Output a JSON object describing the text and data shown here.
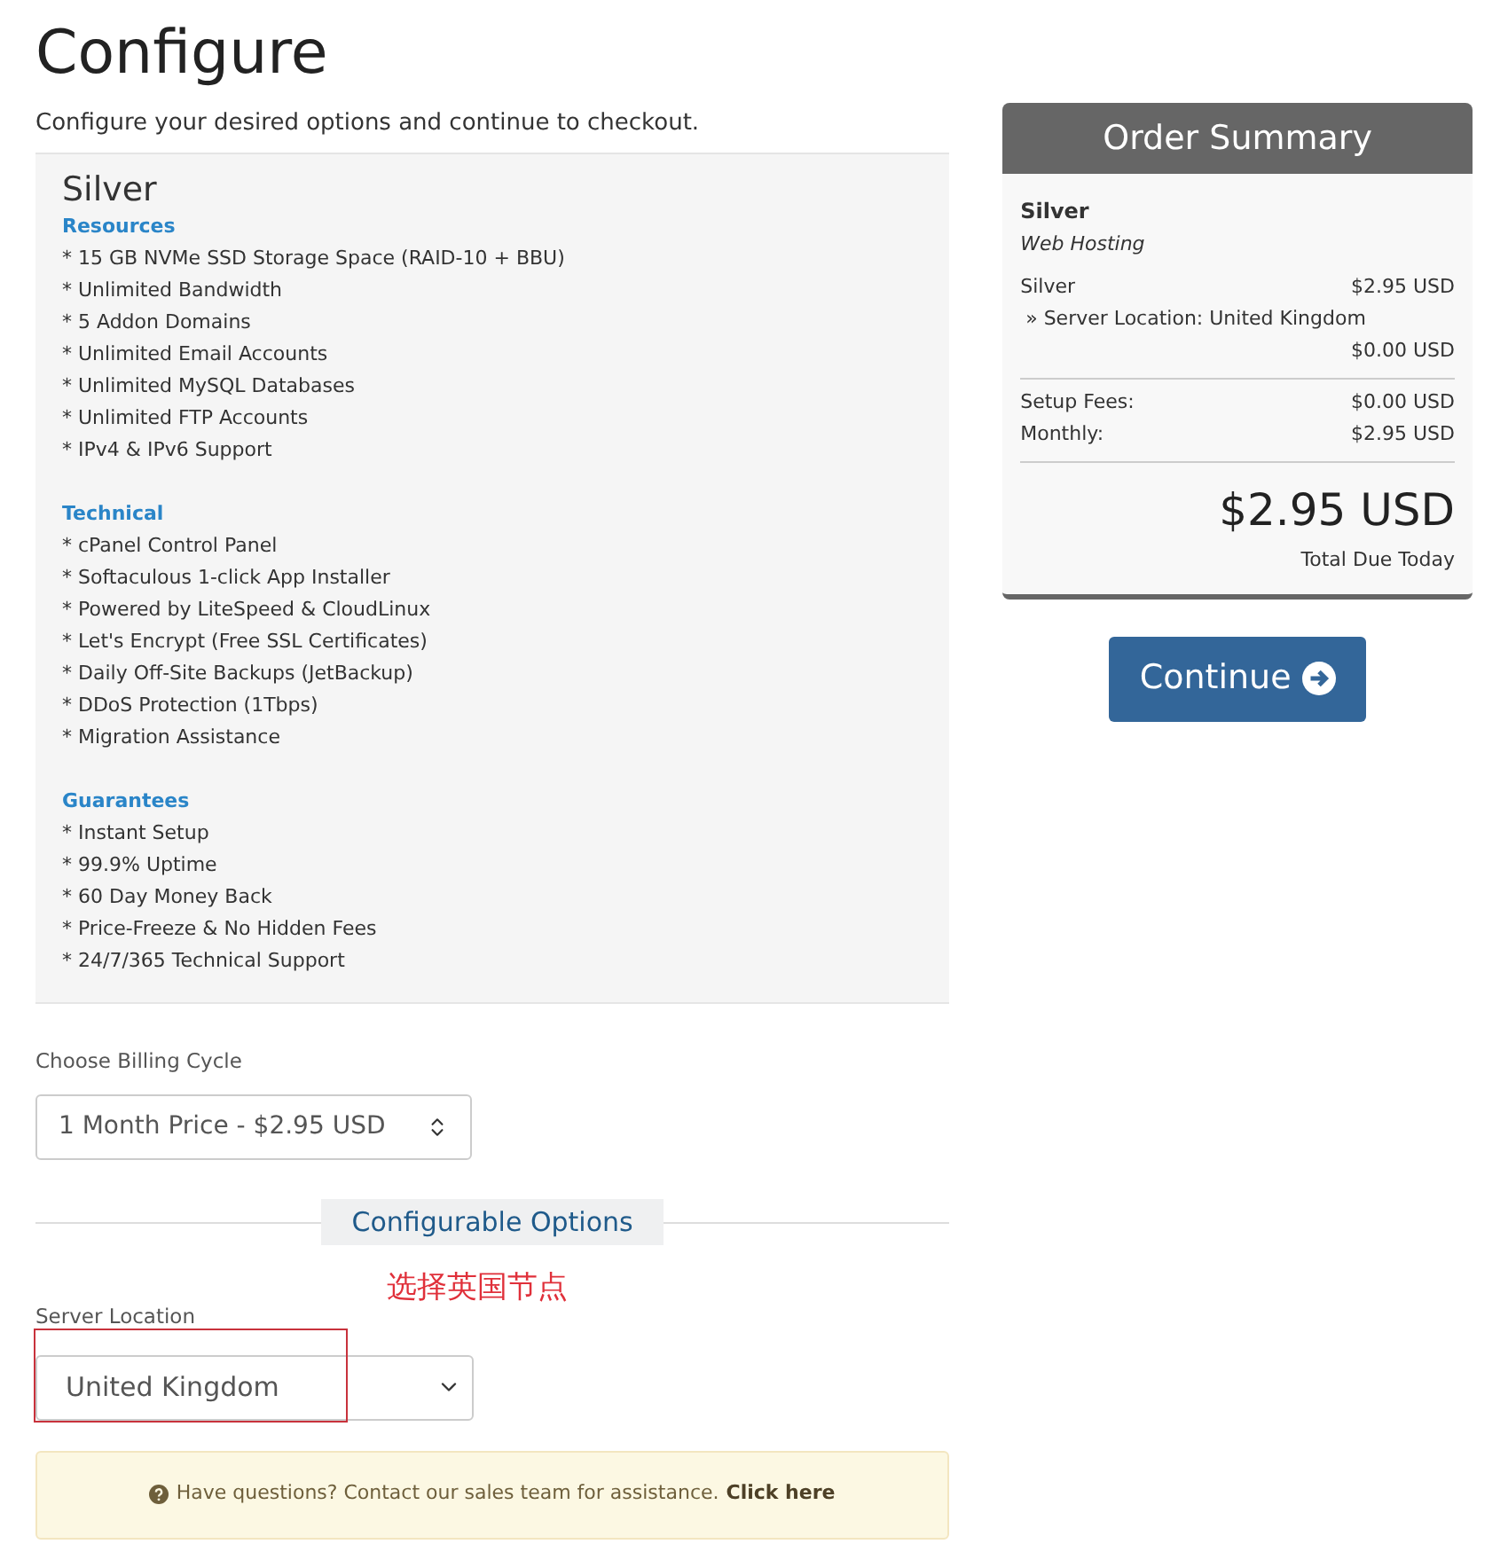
{
  "page": {
    "title": "Configure",
    "subtitle": "Configure your desired options and continue to checkout."
  },
  "product": {
    "name": "Silver",
    "sections": [
      {
        "heading": "Resources",
        "lines": [
          "* 15 GB NVMe SSD Storage Space (RAID-10 + BBU)",
          "* Unlimited Bandwidth",
          "* 5 Addon Domains",
          "* Unlimited Email Accounts",
          "* Unlimited MySQL Databases",
          "* Unlimited FTP Accounts",
          "* IPv4 & IPv6 Support"
        ]
      },
      {
        "heading": "Technical",
        "lines": [
          "* cPanel Control Panel",
          "* Softaculous 1-click App Installer",
          "* Powered by LiteSpeed & CloudLinux",
          "* Let's Encrypt (Free SSL Certificates)",
          "* Daily Off-Site Backups (JetBackup)",
          "* DDoS Protection (1Tbps)",
          "* Migration Assistance"
        ]
      },
      {
        "heading": "Guarantees",
        "lines": [
          "* Instant Setup",
          "* 99.9% Uptime",
          "* 60 Day Money Back",
          "* Price-Freeze & No Hidden Fees",
          "* 24/7/365 Technical Support"
        ]
      }
    ]
  },
  "billing": {
    "label": "Choose Billing Cycle",
    "value": "1 Month Price - $2.95 USD"
  },
  "configurable_options": {
    "heading": "Configurable Options",
    "fields": [
      {
        "label": "Server Location",
        "value": "United Kingdom"
      }
    ]
  },
  "annotation": {
    "text": "选择英国节点"
  },
  "help": {
    "text": "Have questions? Contact our sales team for assistance.",
    "link": "Click here"
  },
  "summary": {
    "title": "Order Summary",
    "product": "Silver",
    "group": "Web Hosting",
    "items": [
      {
        "label": "Silver",
        "price": "$2.95 USD"
      },
      {
        "label": "» Server Location: United Kingdom",
        "price": "$0.00 USD"
      }
    ],
    "fees": [
      {
        "label": "Setup Fees:",
        "price": "$0.00 USD"
      },
      {
        "label": "Monthly:",
        "price": "$2.95 USD"
      }
    ],
    "total": "$2.95 USD",
    "total_label": "Total Due Today"
  },
  "continue_button": "Continue"
}
